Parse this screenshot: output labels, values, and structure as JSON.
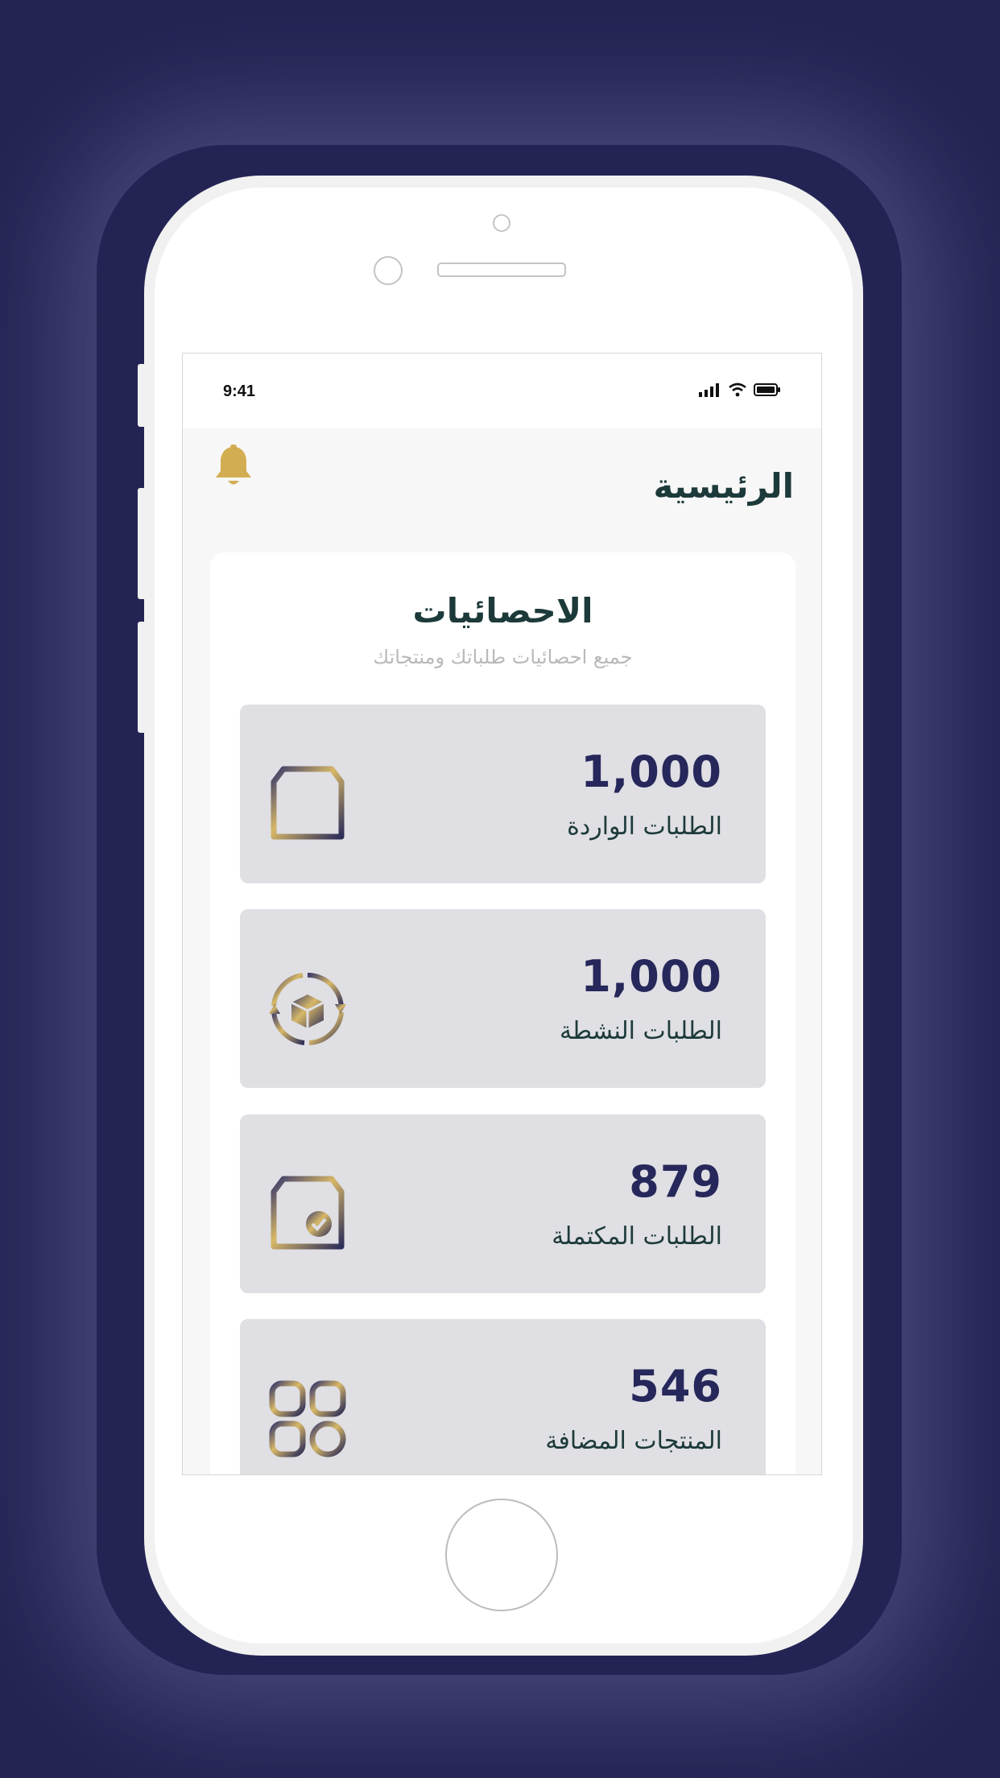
{
  "status_bar": {
    "time": "9:41"
  },
  "header": {
    "title": "الرئيسية"
  },
  "stats_card": {
    "title": "الاحصائيات",
    "subtitle": "جميع احصائيات طلباتك ومنتجاتك",
    "items": [
      {
        "value": "1,000",
        "label": "الطلبات الواردة",
        "icon": "box-add-icon"
      },
      {
        "value": "1,000",
        "label": "الطلبات النشطة",
        "icon": "box-sync-icon"
      },
      {
        "value": "879",
        "label": "الطلبات المكتملة",
        "icon": "box-check-icon"
      },
      {
        "value": "546",
        "label": "المنتجات المضافة",
        "icon": "grid-apps-icon"
      }
    ]
  },
  "colors": {
    "background": "#242454",
    "accent_gold": "#C9A85A",
    "value_navy": "#26275A",
    "title_dark": "#1D3A3A",
    "stat_bg": "#DFDFE4"
  }
}
